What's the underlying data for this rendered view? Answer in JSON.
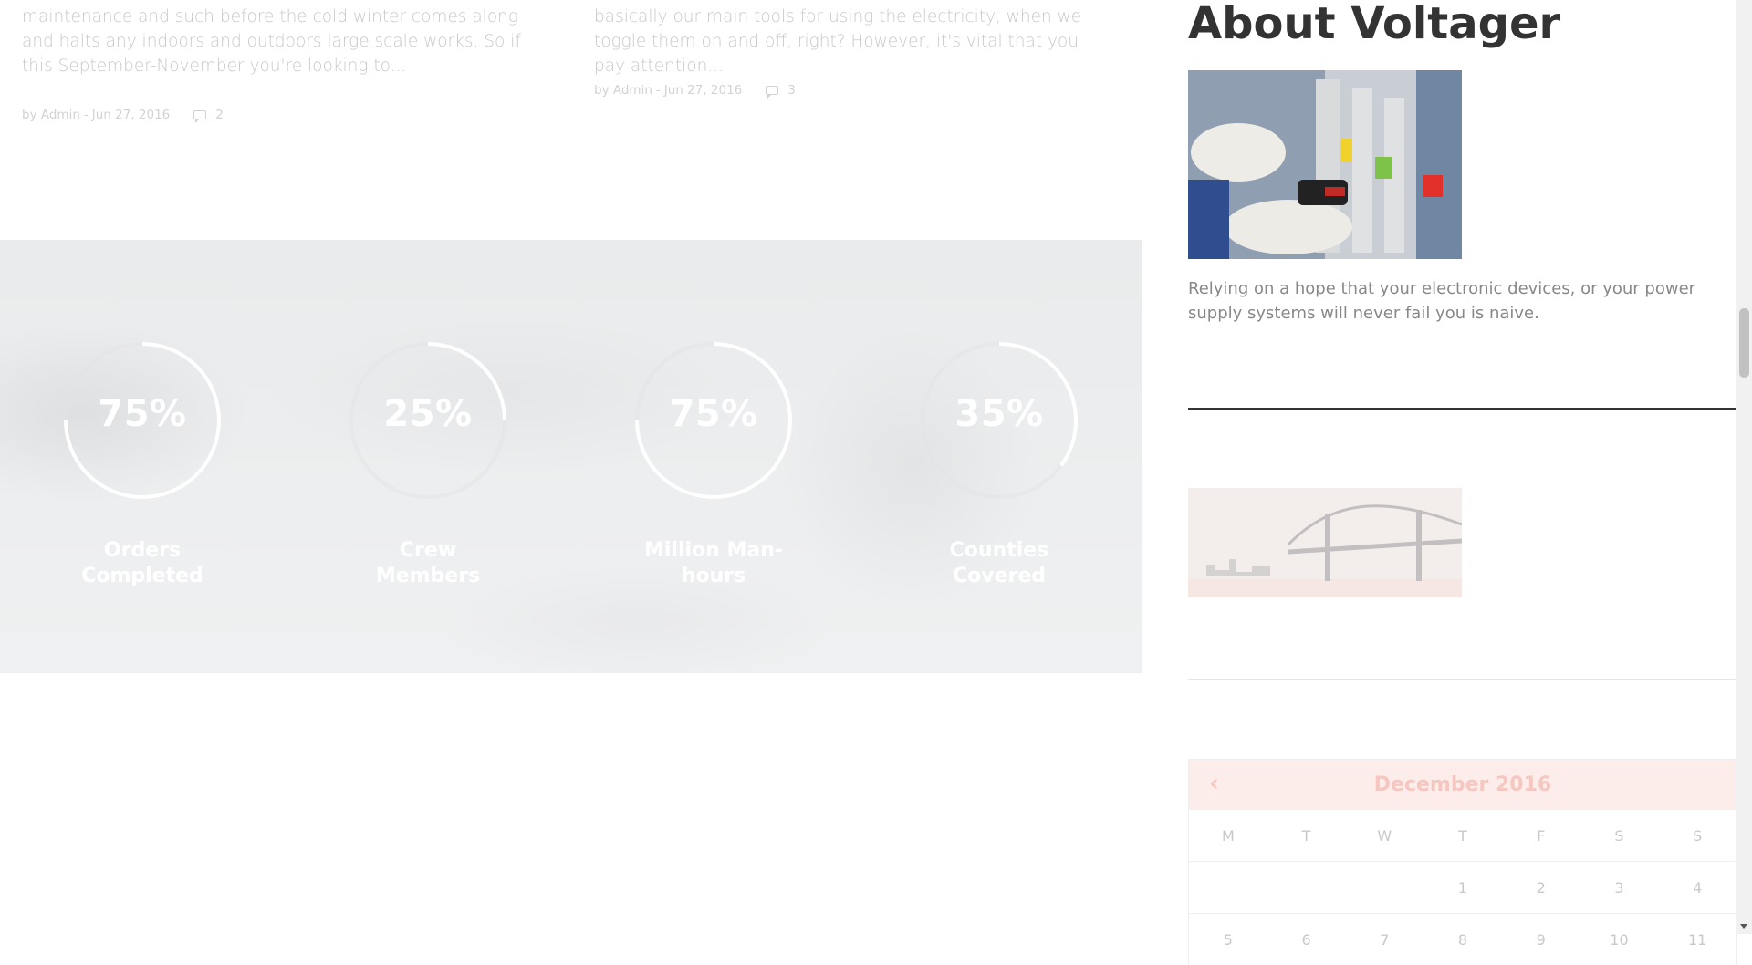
{
  "posts": [
    {
      "excerpt": "maintenance and such before the cold winter comes along and halts any indoors and outdoors large scale works. So if this September-November you're looking to...",
      "author": "by Admin",
      "date": "Jun 27, 2016",
      "comments": "2"
    },
    {
      "excerpt": "basically our main tools for using the electricity, when we toggle them on and off, right? However, it's vital that you pay attention...",
      "author": "by Admin",
      "date": "Jun 27, 2016",
      "comments": "3"
    }
  ],
  "counters": [
    {
      "value": "75%",
      "label": "Orders Completed",
      "fraction": 0.75
    },
    {
      "value": "25%",
      "label": "Crew Members",
      "fraction": 0.25
    },
    {
      "value": "75%",
      "label": "Million Man-hours",
      "fraction": 0.75
    },
    {
      "value": "35%",
      "label": "Counties Covered",
      "fraction": 0.35
    }
  ],
  "sidebar": {
    "about_title": "About Voltager",
    "about_text": "Relying on a hope that your electronic devices, or your power supply systems will never fail you is naive."
  },
  "calendar": {
    "prev": "‹",
    "title": "December 2016",
    "weekdays": [
      "M",
      "T",
      "W",
      "T",
      "F",
      "S",
      "S"
    ],
    "week1": [
      "",
      "",
      "",
      "1",
      "2",
      "3",
      "4"
    ],
    "week2": [
      "5",
      "6",
      "7",
      "8",
      "9",
      "10",
      "11"
    ]
  },
  "colors": {
    "accent": "#f6c7c1",
    "ring": "#ffffff",
    "ring_track": "#e3e4e5"
  }
}
